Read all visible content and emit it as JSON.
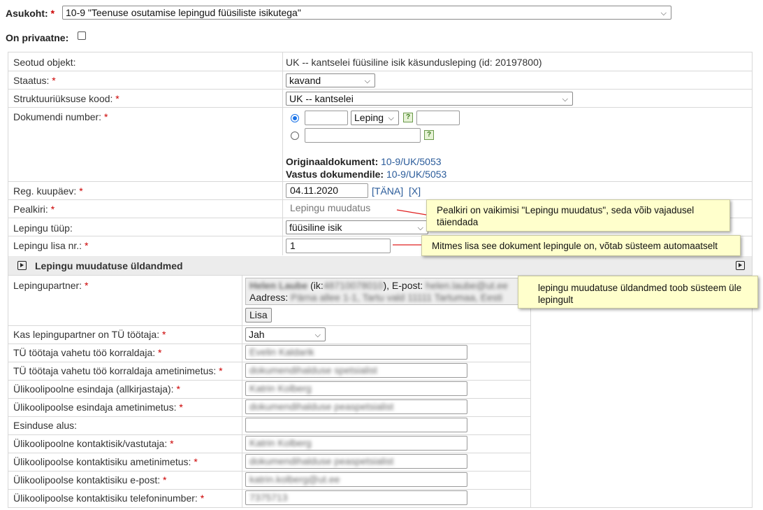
{
  "top": {
    "location_label": "Asukoht:",
    "location_value": "10-9 \"Teenuse osutamise lepingud füüsiliste isikutega\"",
    "private_label": "On privaatne:"
  },
  "rows": {
    "linked_object": {
      "label": "Seotud objekt:",
      "value": "UK -- kantselei füüsiline isik käsundusleping (id: 20197800)"
    },
    "status": {
      "label": "Staatus:",
      "value": "kavand"
    },
    "unit_code": {
      "label": "Struktuuriüksuse kood:",
      "value": "UK -- kantselei"
    },
    "doc_number": {
      "label": "Dokumendi number:",
      "type_value": "Leping",
      "help": "?",
      "original_label": "Originaaldokument:",
      "original_value": "10-9/UK/5053",
      "reply_label": "Vastus dokumendile:",
      "reply_value": "10-9/UK/5053"
    },
    "reg_date": {
      "label": "Reg. kuupäev:",
      "value": "04.11.2020",
      "today": "[TÄNA]",
      "clear": "[X]"
    },
    "title": {
      "label": "Pealkiri:",
      "value": "Lepingu muudatus"
    },
    "contract_type": {
      "label": "Lepingu tüüp:",
      "value": "füüsiline isik"
    },
    "annex_no": {
      "label": "Lepingu lisa nr.:",
      "value": "1"
    }
  },
  "section": {
    "title": "Lepingu muudatuse üldandmed"
  },
  "section_rows": {
    "partner": {
      "label": "Lepingupartner:",
      "name": "Helen Laube",
      "id_prefix": "(ik:",
      "id_value": "48710078010",
      "email_prefix": "), E-post:",
      "email_value": "helen.laube@ut.ee",
      "address_label": "Aadress:",
      "address_value": "Pärna allee 1-1, Tartu vald 11111 Tartumaa, Eesti",
      "add_button": "Lisa"
    },
    "is_employee": {
      "label": "Kas lepingupartner on TÜ töötaja:",
      "value": "Jah"
    },
    "manager": {
      "label": "TÜ töötaja vahetu töö korraldaja:",
      "value": "Evelin Kaldarik"
    },
    "manager_title": {
      "label": "TÜ töötaja vahetu töö korraldaja ametinimetus:",
      "value": "dokumendihalduse spetsialist"
    },
    "representative": {
      "label": "Ülikoolipoolne esindaja (allkirjastaja):",
      "value": "Katrin Kolberg"
    },
    "representative_title": {
      "label": "Ülikoolipoolse esindaja ametinimetus:",
      "value": "dokumendihalduse peaspetsialist"
    },
    "basis": {
      "label": "Esinduse alus:",
      "value": ""
    },
    "contact": {
      "label": "Ülikoolipoolne kontaktisik/vastutaja:",
      "value": "Katrin Kolberg"
    },
    "contact_title": {
      "label": "Ülikoolipoolse kontaktisiku ametinimetus:",
      "value": "dokumendihalduse peaspetsialist"
    },
    "contact_email": {
      "label": "Ülikoolipoolse kontaktisiku e-post:",
      "value": "katrin.kolberg@ut.ee"
    },
    "contact_phone": {
      "label": "Ülikoolipoolse kontaktisiku telefoninumber:",
      "value": "7375713"
    }
  },
  "notes": {
    "title_note": "Pealkiri on vaikimisi \"Lepingu muudatus\", seda võib vajadusel täiendada",
    "annex_note": "Mitmes lisa see dokument lepingule on, võtab süsteem automaatselt",
    "section_note": "lepingu muudatuse üldandmed toob süsteem üle lepingult"
  },
  "required_mark": "*",
  "colors": {
    "note_bg": "#ffffcc",
    "arrow": "#e02020",
    "link": "#2a5b9a",
    "required": "#cc0000"
  }
}
